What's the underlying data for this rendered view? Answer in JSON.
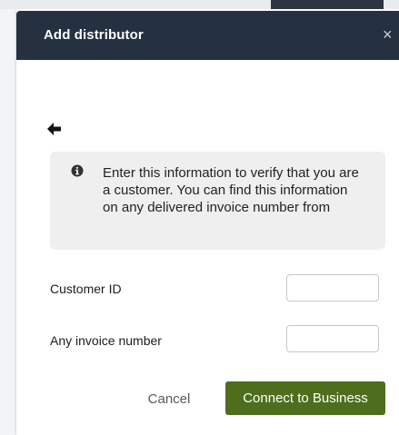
{
  "dialog": {
    "title": "Add distributor",
    "close_icon": "close-icon",
    "back_icon": "arrow-left-icon"
  },
  "info": {
    "icon": "info-circle-icon",
    "message": "Enter this information to verify that you are a customer. You can find this information on any delivered invoice number from"
  },
  "form": {
    "customer_id_label": "Customer ID",
    "customer_id_value": "",
    "invoice_label": "Any invoice number",
    "invoice_value": ""
  },
  "actions": {
    "cancel_label": "Cancel",
    "connect_label": "Connect to Business"
  },
  "colors": {
    "header_bg": "#253040",
    "primary_button": "#4f6e1d",
    "info_box_bg": "#efefef"
  }
}
